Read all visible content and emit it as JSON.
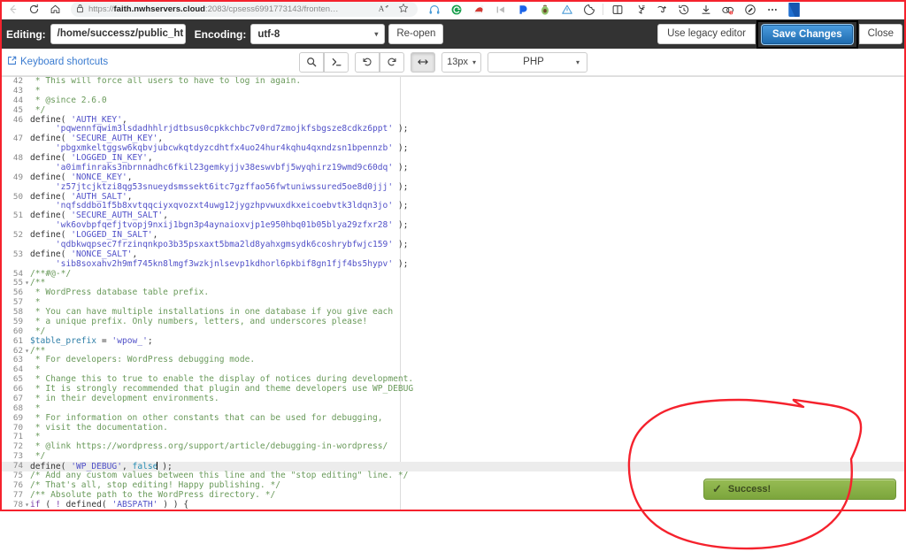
{
  "browser": {
    "back_icon": "back-arrow-icon",
    "reload_icon": "reload-icon",
    "home_icon": "home-icon",
    "lock_icon": "lock-icon",
    "url_prefix": "https://",
    "url_host": "faith.nwhservers.cloud",
    "url_rest": ":2083/cpsess6991773143/fronten…",
    "read_aloud_icon": "read-aloud-icon",
    "favorite_icon": "star-icon",
    "extensions": [
      "headphones-icon",
      "shield-green-icon",
      "santa-hat-icon",
      "skip-back-icon",
      "dashlane-icon",
      "avocado-icon",
      "adblock-icon",
      "cookie-icon"
    ],
    "tools": [
      "split-screen-icon",
      "collections-icon",
      "browser-essentials-icon",
      "history-icon",
      "downloads-icon",
      "copilot-icon",
      "screenshot-icon",
      "more-icon",
      "profile-icon"
    ]
  },
  "header": {
    "editing_label": "Editing:",
    "file_path": "/home/successz/public_ht",
    "encoding_label": "Encoding:",
    "encoding_value": "utf-8",
    "reopen_label": "Re-open",
    "legacy_label": "Use legacy editor",
    "save_label": "Save Changes",
    "close_label": "Close"
  },
  "toolbar": {
    "shortcuts_label": "Keyboard shortcuts",
    "external_link_icon": "external-link-icon",
    "search_icon": "search-icon",
    "console_icon": "console-prompt-icon",
    "undo_icon": "undo-icon",
    "redo_icon": "redo-icon",
    "wrap_icon": "word-wrap-icon",
    "font_size": "13px",
    "mode": "PHP"
  },
  "toast": {
    "check_icon": "check-icon",
    "message": "Success!"
  },
  "colors": {
    "header_bg": "#333333",
    "save_blue": "#2b7dc2",
    "toast_green": "#7ca53c",
    "annotation_red": "#f5222d",
    "link_blue": "#3a7bd0"
  },
  "editor": {
    "first_line": 42,
    "cursor_line": 74,
    "lines": [
      {
        "n": 42,
        "html": "<span class='c-com'> * This will force all users to have to log in again.</span>"
      },
      {
        "n": 43,
        "html": "<span class='c-com'> *</span>"
      },
      {
        "n": 44,
        "html": "<span class='c-com'> * @since 2.6.0</span>"
      },
      {
        "n": 45,
        "html": "<span class='c-com'> */</span>"
      },
      {
        "n": 46,
        "html": "<span class='c-fn'>define</span>( <span class='c-str'>'AUTH_KEY'</span>,"
      },
      {
        "n": "",
        "html": "     <span class='c-str'>'pqwennfqwim3lsdadhhlrjdtbsus0cpkkchbc7v0rd7zmojkfsbgsze8cdkz6ppt'</span> );"
      },
      {
        "n": 47,
        "html": "<span class='c-fn'>define</span>( <span class='c-str'>'SECURE_AUTH_KEY'</span>,"
      },
      {
        "n": "",
        "html": "     <span class='c-str'>'pbgxmkeltggsw6kqbvjubcwkqtdyzcdhtfx4uo24hur4kqhu4qxndzsn1bpennzb'</span> );"
      },
      {
        "n": 48,
        "html": "<span class='c-fn'>define</span>( <span class='c-str'>'LOGGED_IN_KEY'</span>,"
      },
      {
        "n": "",
        "html": "     <span class='c-str'>'a0imfinraks3nbrnnadhc6fkil23gemkyjjv38eswvbfj5wyqhirz19wmd9c60dq'</span> );"
      },
      {
        "n": 49,
        "html": "<span class='c-fn'>define</span>( <span class='c-str'>'NONCE_KEY'</span>,"
      },
      {
        "n": "",
        "html": "     <span class='c-str'>'z57jtcjktzi8qg53snueydsmssekt6itc7gzffao56fwtuniwssured5oe8d0jjj'</span> );"
      },
      {
        "n": 50,
        "html": "<span class='c-fn'>define</span>( <span class='c-str'>'AUTH_SALT'</span>,"
      },
      {
        "n": "",
        "html": "     <span class='c-str'>'nqfsddbo1f5b8xvtqqciyxqvozxt4uwg12jygzhpvwuxdkxeicoebvtk3ldqn3jo'</span> );"
      },
      {
        "n": 51,
        "html": "<span class='c-fn'>define</span>( <span class='c-str'>'SECURE_AUTH_SALT'</span>,"
      },
      {
        "n": "",
        "html": "     <span class='c-str'>'wk6ovbpfqefjtvopj9nxij1bgn3p4aynaioxvjp1e950hbq01b05blya29zfxr28'</span> );"
      },
      {
        "n": 52,
        "html": "<span class='c-fn'>define</span>( <span class='c-str'>'LOGGED_IN_SALT'</span>,"
      },
      {
        "n": "",
        "html": "     <span class='c-str'>'qdbkwqpsec7frzinqnkpo3b35psxaxt5bma2ld8yahxgmsydk6coshrybfwjc159'</span> );"
      },
      {
        "n": 53,
        "html": "<span class='c-fn'>define</span>( <span class='c-str'>'NONCE_SALT'</span>,"
      },
      {
        "n": "",
        "html": "     <span class='c-str'>'sib8soxahv2h9mf745kn8lmgf3wzkjnlsevp1kdhorl6pkbif8gn1fjf4bs5hypv'</span> );"
      },
      {
        "n": 54,
        "html": "<span class='c-com'>/**#@-*/</span>"
      },
      {
        "n": 55,
        "fold": true,
        "html": "<span class='c-com'>/**</span>"
      },
      {
        "n": 56,
        "html": "<span class='c-com'> * WordPress database table prefix.</span>"
      },
      {
        "n": 57,
        "html": "<span class='c-com'> *</span>"
      },
      {
        "n": 58,
        "html": "<span class='c-com'> * You can have multiple installations in one database if you give each</span>"
      },
      {
        "n": 59,
        "html": "<span class='c-com'> * a unique prefix. Only numbers, letters, and underscores please!</span>"
      },
      {
        "n": 60,
        "html": "<span class='c-com'> */</span>"
      },
      {
        "n": 61,
        "html": "<span class='c-var'>$table_prefix</span> = <span class='c-str'>'wpow_'</span>;"
      },
      {
        "n": 62,
        "fold": true,
        "html": "<span class='c-com'>/**</span>"
      },
      {
        "n": 63,
        "html": "<span class='c-com'> * For developers: WordPress debugging mode.</span>"
      },
      {
        "n": 64,
        "html": "<span class='c-com'> *</span>"
      },
      {
        "n": 65,
        "html": "<span class='c-com'> * Change this to true to enable the display of notices during development.</span>"
      },
      {
        "n": 66,
        "html": "<span class='c-com'> * It is strongly recommended that plugin and theme developers use WP_DEBUG</span>"
      },
      {
        "n": 67,
        "html": "<span class='c-com'> * in their development environments.</span>"
      },
      {
        "n": 68,
        "html": "<span class='c-com'> *</span>"
      },
      {
        "n": 69,
        "html": "<span class='c-com'> * For information on other constants that can be used for debugging,</span>"
      },
      {
        "n": 70,
        "html": "<span class='c-com'> * visit the documentation.</span>"
      },
      {
        "n": 71,
        "html": "<span class='c-com'> *</span>"
      },
      {
        "n": 72,
        "html": "<span class='c-com'> * @link https://wordpress.org/support/article/debugging-in-wordpress/</span>"
      },
      {
        "n": 73,
        "html": "<span class='c-com'> */</span>"
      },
      {
        "n": 74,
        "hl": true,
        "html": "<span class='c-fn'>define</span>( <span class='c-str'>'WP_DEBUG'</span>, <span class='c-atom'>false</span><span class='cursor'></span> );"
      },
      {
        "n": 75,
        "html": "<span class='c-com'>/* Add any custom values between this line and the \"stop editing\" line. */</span>"
      },
      {
        "n": 76,
        "html": "<span class='c-com'>/* That's all, stop editing! Happy publishing. */</span>"
      },
      {
        "n": 77,
        "html": "<span class='c-com'>/** Absolute path to the WordPress directory. */</span>"
      },
      {
        "n": 78,
        "fold": true,
        "html": "<span class='c-kw'>if</span> ( <span class='c-kw'>!</span> <span class='c-fn'>defined</span>( <span class='c-str'>'ABSPATH'</span> ) ) {"
      }
    ]
  }
}
